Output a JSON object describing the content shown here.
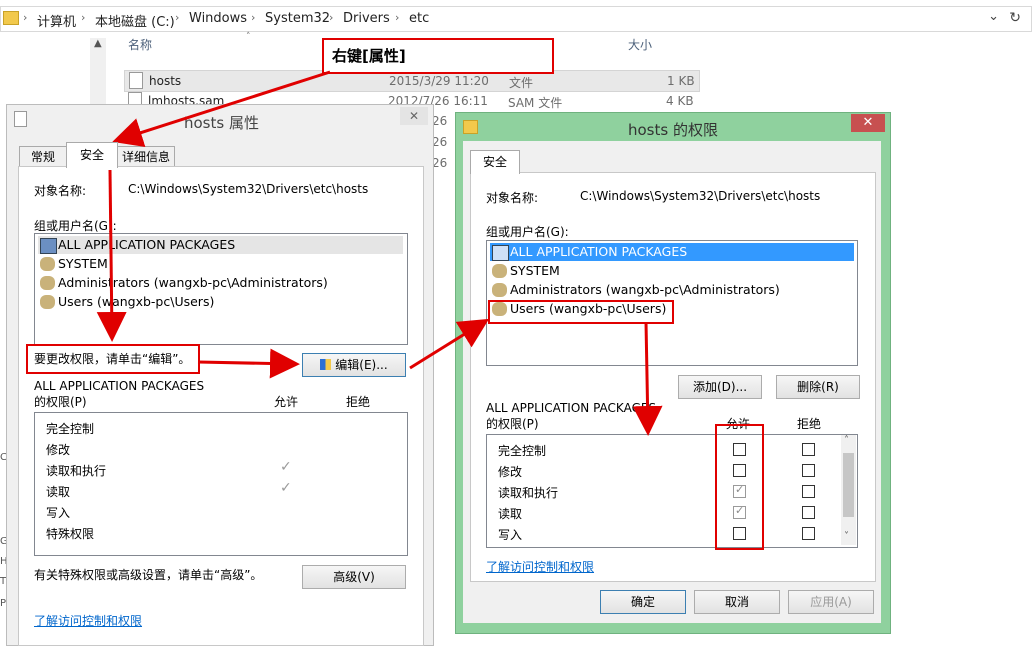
{
  "explorer": {
    "breadcrumb": [
      "计算机",
      "本地磁盘 (C:)",
      "Windows",
      "System32",
      "Drivers",
      "etc"
    ],
    "columns": {
      "name": "名称",
      "size": "大小"
    },
    "files": [
      {
        "name": "hosts",
        "date": "2015/3/29 11:20",
        "type": "文件",
        "size": "1 KB"
      },
      {
        "name": "lmhosts.sam",
        "date": "2012/7/26 16:11",
        "type": "SAM 文件",
        "size": "4 KB"
      }
    ],
    "hidden_dates": [
      "26",
      "26",
      "26"
    ],
    "left_chars": [
      "C",
      "G",
      "H",
      "T",
      "P"
    ]
  },
  "annotation": {
    "right_click": "右键[属性]"
  },
  "props": {
    "title": "hosts 属性",
    "tabs": [
      "常规",
      "安全",
      "详细信息"
    ],
    "object_label": "对象名称:",
    "object_value": "C:\\Windows\\System32\\Drivers\\etc\\hosts",
    "group_label": "组或用户名(G):",
    "users": [
      "ALL APPLICATION PACKAGES",
      "SYSTEM",
      "Administrators (wangxb-pc\\Administrators)",
      "Users (wangxb-pc\\Users)"
    ],
    "change_hint": "要更改权限，请单击“编辑”。",
    "edit_button": "编辑(E)...",
    "perm_for_line1": "ALL APPLICATION PACKAGES",
    "perm_for_line2": "的权限(P)",
    "allow": "允许",
    "deny": "拒绝",
    "permissions": [
      "完全控制",
      "修改",
      "读取和执行",
      "读取",
      "写入",
      "特殊权限"
    ],
    "allowed": [
      false,
      false,
      true,
      true,
      false,
      false
    ],
    "advanced_hint": "有关特殊权限或高级设置，请单击“高级”。",
    "advanced_button": "高级(V)",
    "learn_link": "了解访问控制和权限"
  },
  "perm_dialog": {
    "title": "hosts 的权限",
    "close": "✕",
    "tab": "安全",
    "object_label": "对象名称:",
    "object_value": "C:\\Windows\\System32\\Drivers\\etc\\hosts",
    "group_label": "组或用户名(G):",
    "users": [
      "ALL APPLICATION PACKAGES",
      "SYSTEM",
      "Administrators (wangxb-pc\\Administrators)",
      "Users (wangxb-pc\\Users)"
    ],
    "add_button": "添加(D)...",
    "remove_button": "删除(R)",
    "perm_for_line1": "ALL APPLICATION PACKAGES",
    "perm_for_line2": "的权限(P)",
    "allow": "允许",
    "deny": "拒绝",
    "permissions": [
      "完全控制",
      "修改",
      "读取和执行",
      "读取",
      "写入"
    ],
    "allowed": [
      false,
      false,
      true,
      true,
      false
    ],
    "denied": [
      false,
      false,
      false,
      false,
      false
    ],
    "learn_link": "了解访问控制和权限",
    "ok": "确定",
    "cancel": "取消",
    "apply": "应用(A)"
  },
  "colors": {
    "annotation_red": "#e00000",
    "selection": "#3399ff",
    "link": "#0066cc",
    "dialog_frame": "#8fd19e"
  }
}
